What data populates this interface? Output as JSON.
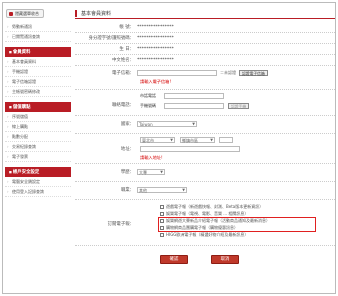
{
  "sidebar": {
    "hide_label": "隱藏選單收合",
    "top_links": [
      "勞動新通訊",
      "已閱覽通訊查詢"
    ],
    "sections": [
      {
        "title": "會員資料",
        "items": [
          "基本會員資料",
          "手機認證",
          "電子信箱認證",
          "主帳號密碼修改"
        ]
      },
      {
        "title": "儲值購點",
        "items": [
          "序號儲值",
          "線上購點",
          "點數分配",
          "交易紀錄查詢",
          "電子發票"
        ]
      },
      {
        "title": "帳戶安全設定",
        "items": [
          "電腦安全鎖設定",
          "使用登入記錄查詢"
        ]
      }
    ]
  },
  "page_title": "基本會員資料",
  "fields": {
    "account": {
      "label": "帳 號：",
      "value": "****************"
    },
    "id": {
      "label": "身分證字號/護照號碼：",
      "value": "****************"
    },
    "birth": {
      "label": "生 日：",
      "value": "****************"
    },
    "name": {
      "label": "中文姓名：",
      "value": "****************"
    },
    "email": {
      "label": "電子信箱：",
      "suffix": "＝未認證",
      "button": "認證電子信箱",
      "warn": "請輸入電子信箱!"
    },
    "phone": {
      "label": "聯絡電話：",
      "home_label": "市話電話",
      "mobile_label": "手機號碼",
      "mobile_button": "認證手機"
    },
    "country": {
      "label": "國家：",
      "value": "Taiwan"
    },
    "address": {
      "label": "地址：",
      "city": "臺北市",
      "district": "鄉鎮市區",
      "warn": "請輸入地址!"
    },
    "degree": {
      "label": "學歷：",
      "value": "大專"
    },
    "job": {
      "label": "職業：",
      "value": "其他"
    },
    "newsletter": {
      "label": "訂閱電子報：",
      "options": [
        "遊戲電子報（新遊戲快報、封測、Beta版本更新資訊）",
        "娛樂電子報（電視、電影、音樂 ... 相關訊息）",
        "娛樂網遊大賽新品介紹電子報（活動商品通知及最新消息）",
        "購物網商品團購電子報（購物優惠訊息）",
        "HIGG歐洲電子報（精選好物介紹及最新訊息）"
      ]
    }
  },
  "buttons": {
    "submit": "確認",
    "cancel": "取消"
  },
  "colors": {
    "accent": "#b91d25",
    "warn": "#d40000"
  }
}
